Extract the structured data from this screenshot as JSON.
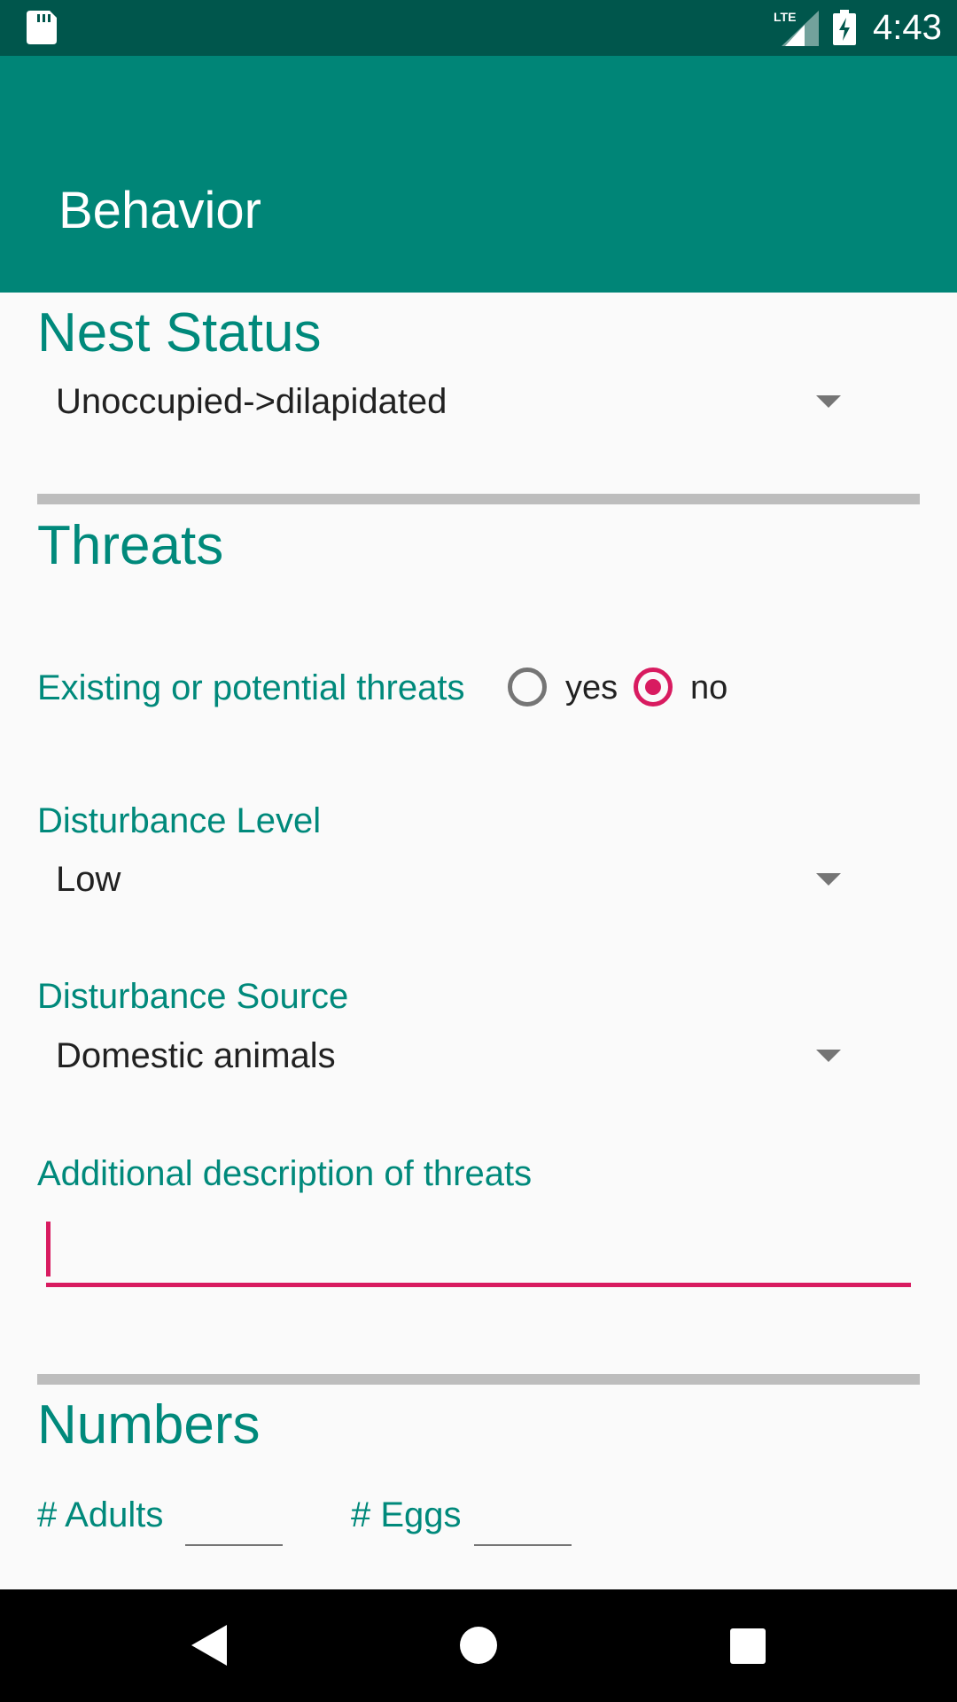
{
  "status_bar": {
    "time": "4:43",
    "network_label": "LTE",
    "icons": [
      "sd-card-icon",
      "lte-signal-icon",
      "battery-charging-icon"
    ]
  },
  "app_bar": {
    "title": "Behavior"
  },
  "nest_status": {
    "title": "Nest Status",
    "selected": "Unoccupied->dilapidated"
  },
  "threats": {
    "title": "Threats",
    "existing_label": "Existing or potential threats",
    "options": {
      "yes": "yes",
      "no": "no"
    },
    "selected_option": "no",
    "disturbance_level_label": "Disturbance Level",
    "disturbance_level_value": "Low",
    "disturbance_source_label": "Disturbance Source",
    "disturbance_source_value": "Domestic animals",
    "additional_label": "Additional description of threats",
    "additional_value": ""
  },
  "numbers": {
    "title": "Numbers",
    "adults_label": "# Adults",
    "adults_value": "",
    "eggs_label": "# Eggs",
    "eggs_value": ""
  },
  "colors": {
    "status_bar": "#00564c",
    "app_bar": "#008577",
    "accent_teal": "#00897b",
    "accent_pink": "#d81b60",
    "background": "#fafafa",
    "divider": "#bdbdbd"
  },
  "nav_bar": {
    "icons": [
      "back-icon",
      "home-icon",
      "recents-icon"
    ]
  }
}
